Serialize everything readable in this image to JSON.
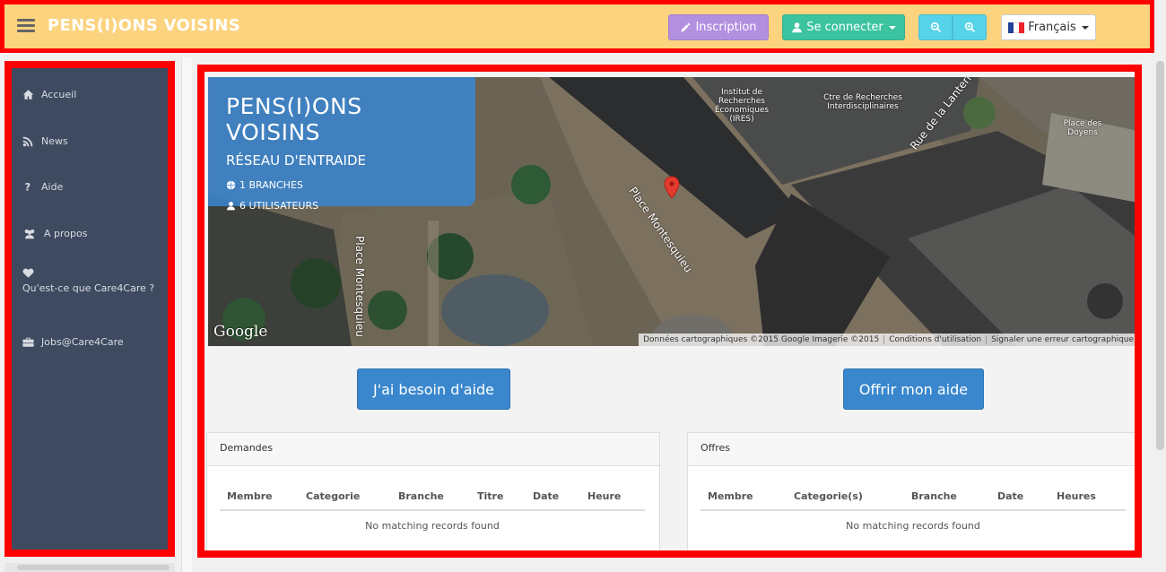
{
  "header": {
    "brand": "PENS(I)ONS VOISINS",
    "inscription_label": "Inscription",
    "connect_label": "Se connecter",
    "language_label": "Français"
  },
  "sidebar": {
    "items": [
      {
        "label": "Accueil",
        "icon": "home-icon"
      },
      {
        "label": "News",
        "icon": "rss-icon"
      },
      {
        "label": "Aide",
        "icon": "question-icon"
      },
      {
        "label": "A propos",
        "icon": "users-icon"
      },
      {
        "label": "Qu'est-ce que Care4Care ?",
        "icon": "heart-icon"
      },
      {
        "label": "Jobs@Care4Care",
        "icon": "briefcase-icon"
      }
    ]
  },
  "map": {
    "title": "PENS(I)ONS VOISINS",
    "subtitle": "RÉSEAU D'ENTRAIDE",
    "branches": "1 BRANCHES",
    "users": "6 UTILISATEURS",
    "labels": {
      "ires": "Institut de Recherches Économiques (IRES)",
      "ctre": "Ctre de Recherches Interdisciplinaires",
      "doyens": "Place des Doyens",
      "road1": "Place Montesquieu",
      "road2": "Place Montesquieu",
      "road3": "Rue de la Lanterne"
    },
    "google": "Google",
    "attribution": [
      "Données cartographiques ©2015 Google Imagerie ©2015",
      "Conditions d'utilisation",
      "Signaler une erreur cartographique"
    ]
  },
  "actions": {
    "need_help": "J'ai besoin d'aide",
    "offer_help": "Offrir mon aide"
  },
  "requests": {
    "title": "Demandes",
    "columns": [
      "Membre",
      "Categorie",
      "Branche",
      "Titre",
      "Date",
      "Heure"
    ],
    "empty": "No matching records found"
  },
  "offers": {
    "title": "Offres",
    "columns": [
      "Membre",
      "Categorie(s)",
      "Branche",
      "Date",
      "Heures"
    ],
    "empty": "No matching records found"
  },
  "colors": {
    "header_bg": "#fcd37f",
    "sidebar_bg": "#3e4a5f",
    "primary": "#3a87cd",
    "inscription": "#b38fe0",
    "connect": "#3cc3a0",
    "zoom": "#56d3e8",
    "highlight": "#ff0000"
  }
}
